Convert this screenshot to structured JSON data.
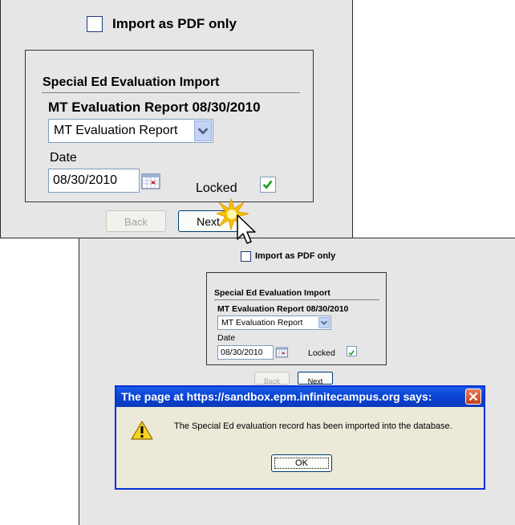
{
  "form": {
    "import_pdf_label": "Import as PDF only",
    "section_title": "Special Ed Evaluation Import",
    "report_heading": "MT Evaluation Report 08/30/2010",
    "report_select_value": "MT Evaluation Report",
    "date_label": "Date",
    "date_value": "08/30/2010",
    "locked_label": "Locked",
    "locked_checked": true,
    "back_label": "Back",
    "next_label": "Next"
  },
  "dialog": {
    "title": "The page at https://sandbox.epm.infinitecampus.org says:",
    "message": "The Special Ed evaluation record has been imported into the database.",
    "ok_label": "OK"
  },
  "icons": {
    "dropdown": "chevron-down-icon",
    "calendar": "calendar-icon",
    "warning": "warning-icon",
    "close": "close-icon",
    "cursor": "mouse-pointer-icon",
    "click_burst": "click-burst-icon"
  },
  "colors": {
    "panel_bg": "#e6e6e6",
    "dialog_bg": "#ece9d8",
    "titlebar_blue": "#0a44d4",
    "close_red": "#c2401b",
    "check_green": "#21a121",
    "click_burst": "#f5c400"
  }
}
